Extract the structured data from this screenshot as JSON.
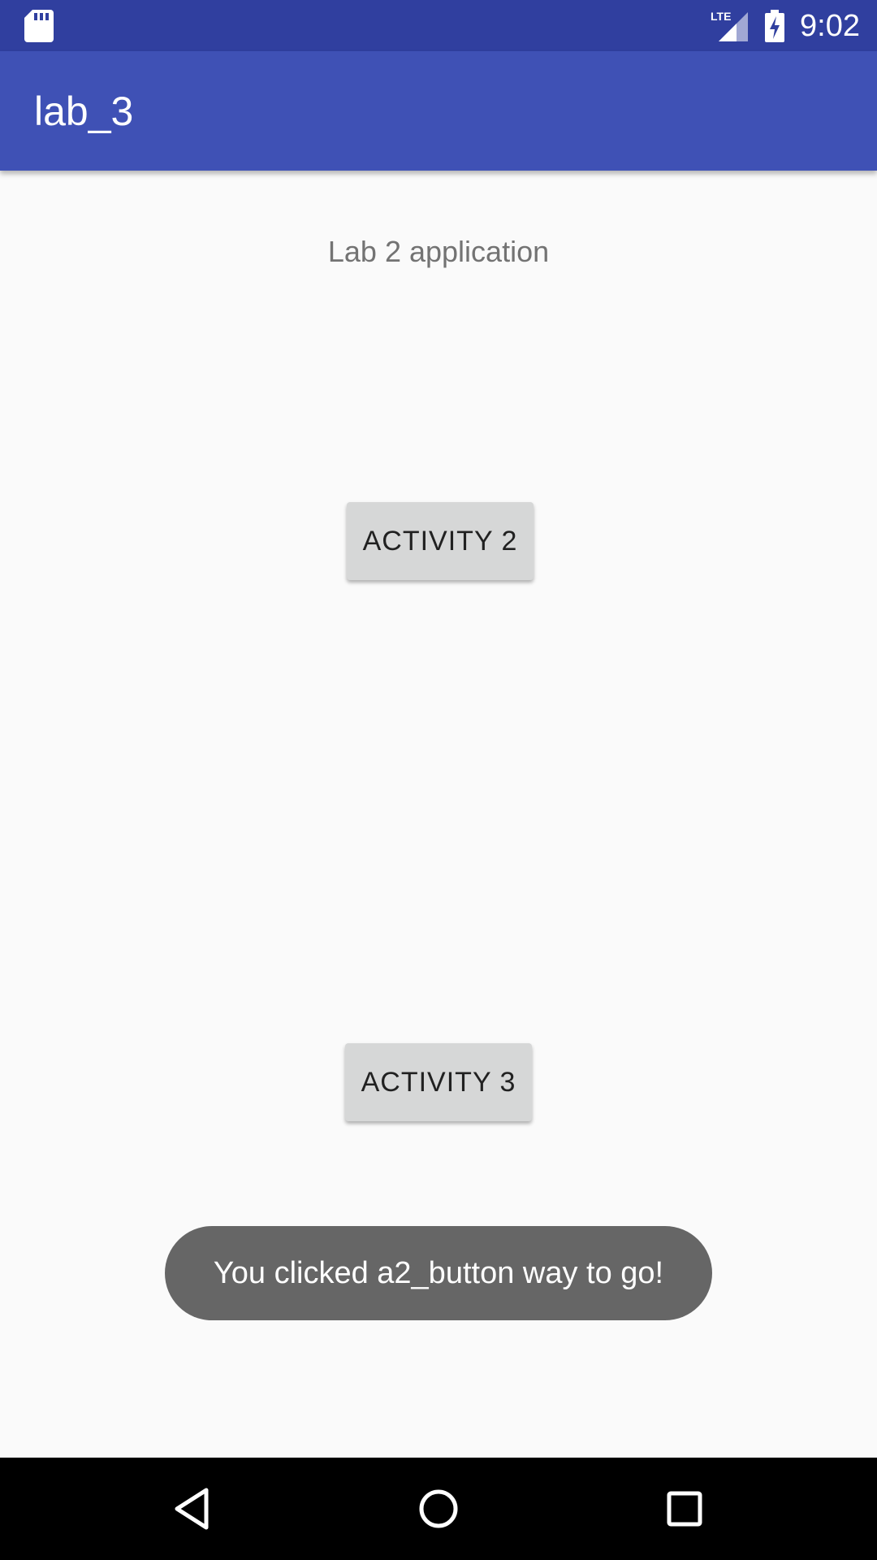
{
  "status_bar": {
    "time": "9:02",
    "network_label": "LTE",
    "icons": [
      "sd-card-icon",
      "lte-signal-icon",
      "battery-charging-icon"
    ]
  },
  "app_bar": {
    "title": "lab_3"
  },
  "main": {
    "subtitle": "Lab 2 application",
    "activity2_label": "ACTIVITY 2",
    "activity3_label": "ACTIVITY 3"
  },
  "toast": {
    "message": "You clicked a2_button way to go!"
  },
  "nav_bar": {
    "icons": [
      "back-icon",
      "home-icon",
      "recents-icon"
    ]
  },
  "colors": {
    "status_bar": "#303f9f",
    "app_bar": "#3f51b5",
    "background": "#fafafa",
    "button": "#d6d7d7",
    "toast": "#666666",
    "nav_bar": "#000000"
  }
}
